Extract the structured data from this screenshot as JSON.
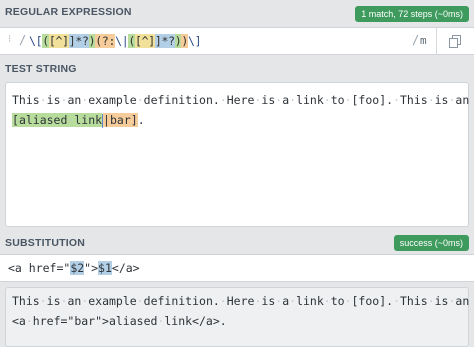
{
  "regex": {
    "section_label": "REGULAR EXPRESSION",
    "badge": "1 match, 72 steps (~0ms)",
    "badge_color": "#3f9a5e",
    "drag_handle": "⁝",
    "delimiter_left": "/",
    "pattern_parts": [
      "\\[",
      "(",
      "[^]",
      "]*?",
      ")",
      "(?:",
      "\\|",
      "(",
      "[^]",
      "]*?",
      ")",
      ")",
      "\\]"
    ],
    "delimiter_right": "/",
    "flags": "m",
    "copy_icon": "copy-icon"
  },
  "test_string": {
    "section_label": "TEST STRING",
    "line1": "This is an example definition. Here is a link to [foo]. This is an",
    "line2_match_open": "[",
    "line2_group1": "aliased link",
    "line2_pipe": "|",
    "line2_group2": "bar",
    "line2_match_close": "]",
    "line2_rest": "."
  },
  "substitution": {
    "section_label": "SUBSTITUTION",
    "badge": "success (~0ms)",
    "badge_color": "#3f9a5e",
    "input_prefix": "<a href=\"",
    "token1": "$2",
    "input_mid": "\">",
    "token2": "$1",
    "input_suffix": "</a>",
    "result_line1": "This is an example definition. Here is a link to [foo]. This is an",
    "result_line2": "<a href=\"bar\">aliased link</a>."
  },
  "colors": {
    "group1": "#b8dc9c",
    "group2": "#f5cc9a",
    "token": "#b2cfe6",
    "section_label": "#4a5663"
  }
}
